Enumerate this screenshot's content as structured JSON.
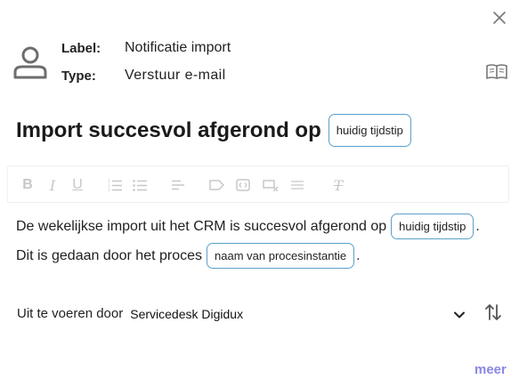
{
  "header": {
    "label_key": "Label:",
    "label_value": "Notificatie import",
    "type_key": "Type:",
    "type_value": "Verstuur e-mail"
  },
  "subject": {
    "title": "Import succesvol afgerond op",
    "chip": "huidig tijdstip"
  },
  "toolbar": {
    "bold": "B",
    "italic": "I",
    "underline": "U",
    "clear": "T"
  },
  "message": {
    "line1_text": "De wekelijkse import uit het CRM is succesvol afgerond op",
    "line1_chip": "huidig tijdstip",
    "line1_end": ".",
    "line2_text": "Dit is gedaan door het proces",
    "line2_chip": "naam van procesinstantie",
    "line2_end": "."
  },
  "executor": {
    "label": "Uit te voeren door",
    "value": "Servicedesk Digidux"
  },
  "footer": {
    "more": "meer"
  },
  "colors": {
    "chip_border": "#5aa0c8",
    "toolbar_icon": "#c7c7c7",
    "link": "#8a86e6"
  }
}
